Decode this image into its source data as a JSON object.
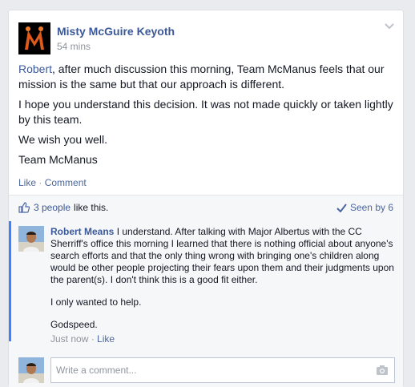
{
  "post": {
    "author": "Misty McGuire Keyoth",
    "timestamp": "54 mins",
    "mention": "Robert",
    "para1_rest": ", after much discussion this morning, Team McManus feels that our mission is the same but that our approach is different.",
    "para2": "I hope you understand this decision. It was not made quickly or taken lightly by this team.",
    "para3": "We wish you well.",
    "para4": "Team McManus",
    "actions": {
      "like": "Like",
      "separator": "·",
      "comment": "Comment"
    }
  },
  "feedback": {
    "likes_people": "3 people",
    "likes_suffix": "like this.",
    "seen": "Seen by 6"
  },
  "comment": {
    "author": "Robert Means",
    "text1": "I understand. After talking with Major Albertus with the CC Sherriff's office this morning I learned that there is nothing official about anyone's search efforts and that the only thing wrong with bringing one's children along would be other people projecting their fears upon them and their judgments upon the parent(s). I don't think this is a good fit either.",
    "text2": "I only wanted to help.",
    "text3": "Godspeed.",
    "time": "Just now",
    "separator": "·",
    "like": "Like"
  },
  "reply": {
    "placeholder": "Write a comment..."
  },
  "colors": {
    "link": "#3b5998",
    "seen_bar": "#4080ff",
    "feedback_bg": "#f6f7f9"
  },
  "icons": [
    "chevron-down-icon",
    "thumbs-up-icon",
    "checkmark-icon",
    "camera-icon"
  ]
}
